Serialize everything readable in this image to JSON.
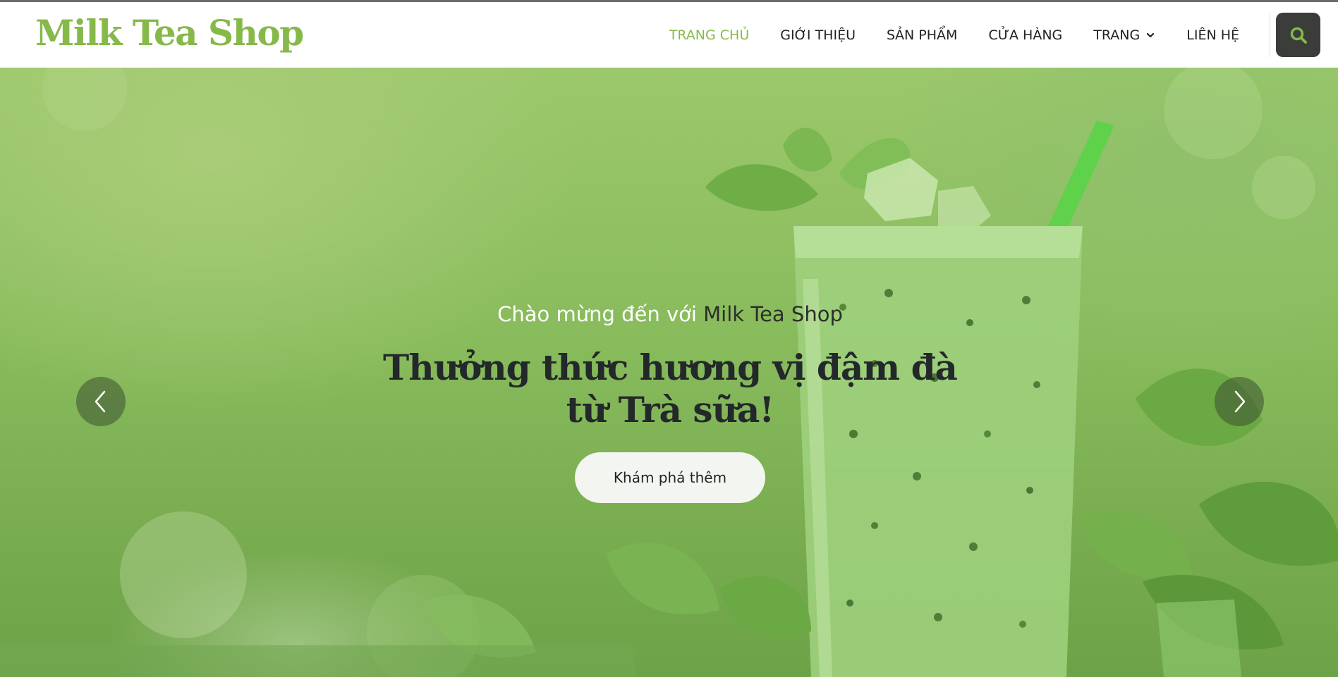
{
  "brand": {
    "name": "Milk Tea Shop"
  },
  "nav": {
    "items": [
      {
        "label": "TRANG CHỦ",
        "active": true
      },
      {
        "label": "GIỚI THIỆU"
      },
      {
        "label": "SẢN PHẨM"
      },
      {
        "label": "CỬA HÀNG"
      },
      {
        "label": "TRANG",
        "has_dropdown": true
      },
      {
        "label": "LIÊN HỆ"
      }
    ],
    "search_icon": "search-icon"
  },
  "hero": {
    "eyebrow_prefix": "Chào mừng đến với",
    "eyebrow_brand": "Milk Tea Shop",
    "headline": "Thưởng thức hương vị đậm đà từ Trà sữa!",
    "cta_label": "Khám phá thêm",
    "prev_icon": "chevron-left-icon",
    "next_icon": "chevron-right-icon"
  },
  "colors": {
    "brand_green": "#86b94a",
    "search_button_bg": "#3a3d3a",
    "headline_text": "#23282a",
    "cta_bg": "#f3f5f1"
  }
}
